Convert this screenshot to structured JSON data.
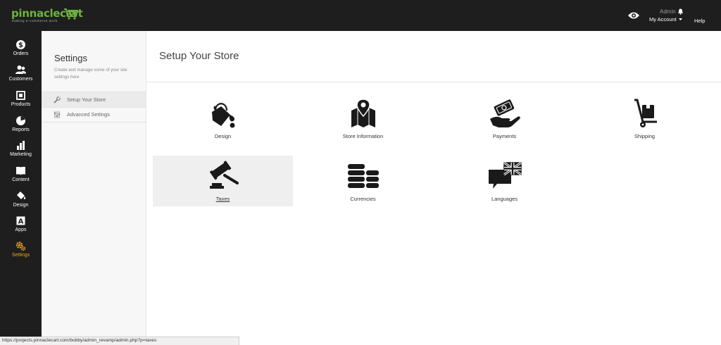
{
  "brand": {
    "name": "pinnaclecart",
    "tagline": "making e-commerce work",
    "color": "#6cb33f"
  },
  "header": {
    "user_name": "Admin",
    "account_label": "My Account",
    "help_label": "Help"
  },
  "nav": {
    "active_color": "#f5a623",
    "items": [
      {
        "label": "Orders",
        "icon": "dollar-icon"
      },
      {
        "label": "Customers",
        "icon": "users-icon"
      },
      {
        "label": "Products",
        "icon": "products-icon"
      },
      {
        "label": "Reports",
        "icon": "pie-chart-icon"
      },
      {
        "label": "Marketing",
        "icon": "bar-chart-icon"
      },
      {
        "label": "Content",
        "icon": "book-icon"
      },
      {
        "label": "Design",
        "icon": "paint-bucket-icon"
      },
      {
        "label": "Apps",
        "icon": "apps-icon"
      },
      {
        "label": "Settings",
        "icon": "gears-icon",
        "active": true
      }
    ]
  },
  "settings_panel": {
    "title": "Settings",
    "description": "Create and manage some of your site settings here",
    "items": [
      {
        "label": "Setup Your Store",
        "icon": "wrench-icon",
        "active": true
      },
      {
        "label": "Advanced Settings",
        "icon": "sliders-icon",
        "active": false
      }
    ]
  },
  "main": {
    "title": "Setup Your Store",
    "tiles": [
      {
        "label": "Design",
        "icon": "paint-bucket-icon"
      },
      {
        "label": "Store Information",
        "icon": "map-pin-icon"
      },
      {
        "label": "Payments",
        "icon": "money-hand-icon"
      },
      {
        "label": "Shipping",
        "icon": "hand-truck-icon"
      },
      {
        "label": "Taxes",
        "icon": "gavel-icon",
        "selected": true
      },
      {
        "label": "Currencies",
        "icon": "coin-stacks-icon"
      },
      {
        "label": "Languages",
        "icon": "speech-flag-icon"
      }
    ]
  },
  "status_bar": {
    "url": "https://projects.pinnaclecart.com/bobby/admin_revamp/admin.php?p=taxes"
  }
}
